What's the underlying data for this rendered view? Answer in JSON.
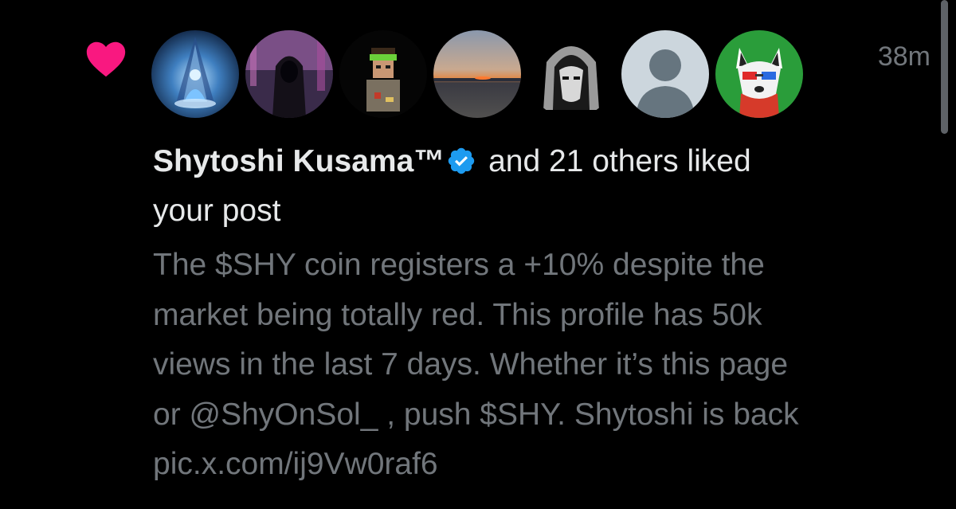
{
  "notification": {
    "type_icon": "heart-icon",
    "timestamp": "38m",
    "avatars": [
      {
        "name": "avatar-meditating-figure"
      },
      {
        "name": "avatar-hooded-figure"
      },
      {
        "name": "avatar-pixel-character"
      },
      {
        "name": "avatar-sunset-beach"
      },
      {
        "name": "avatar-hooded-mask"
      },
      {
        "name": "avatar-default"
      },
      {
        "name": "avatar-shiba-dog"
      }
    ],
    "author": "Shytoshi Kusama™",
    "verified_icon": "verified-badge-icon",
    "action_text": " and 21 others liked",
    "action_text_2": "your post",
    "post_lines": [
      "The $SHY coin registers a +10% despite the",
      "market being totally red. This profile has 50k",
      "views in the last 7 days. Whether it’s this page",
      "or @ShyOnSol_ , push $SHY. Shytoshi is back",
      "pic.x.com/ij9Vw0raf6"
    ]
  },
  "colors": {
    "background": "#000000",
    "heart": "#f91880",
    "primary_text": "#e7e9ea",
    "secondary_text": "#71767b",
    "verified": "#1d9bf0"
  }
}
